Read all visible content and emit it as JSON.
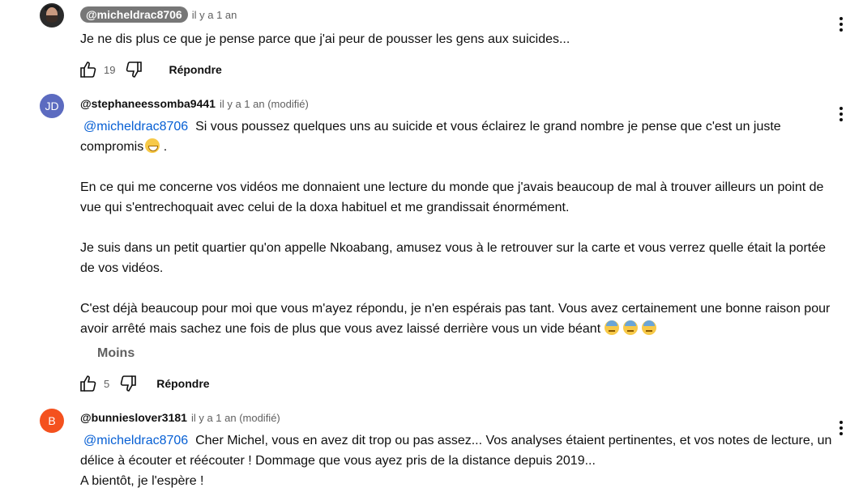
{
  "comments": [
    {
      "author": "@micheldrac8706",
      "time": "il y a 1 an",
      "text": "Je ne dis plus ce que je pense parce que j'ai peur de pousser les gens aux suicides...",
      "likes": "19",
      "reply_label": "Répondre"
    },
    {
      "author": "@stephaneessomba9441",
      "avatar_initials": "JD",
      "time": "il y a 1 an (modifié)",
      "mention": "@micheldrac8706",
      "p1": "Si vous poussez quelques uns au suicide et vous éclairez le grand nombre je pense que c'est un juste compromis",
      "p1_end": ".",
      "p2": "En ce qui me concerne vos vidéos me donnaient une lecture du monde que j'avais beaucoup de mal à trouver ailleurs un point de vue qui s'entrechoquait avec celui de la doxa habituel et me grandissait énormément.",
      "p3": "Je suis dans un petit quartier qu'on appelle Nkoabang, amusez vous à le retrouver sur la carte et vous verrez quelle était la portée de vos vidéos.",
      "p4": "C'est déjà beaucoup pour moi que vous m'ayez répondu, je n'en espérais pas tant. Vous avez certainement une bonne raison pour avoir arrêté mais sachez une fois de plus que vous avez laissé derrière vous un vide béant",
      "show_less": "Moins",
      "likes": "5",
      "reply_label": "Répondre"
    },
    {
      "author": "@bunnieslover3181",
      "avatar_initials": "B",
      "time": "il y a 1 an (modifié)",
      "mention": "@micheldrac8706",
      "text": "Cher Michel, vous en avez dit trop ou pas assez... Vos analyses étaient pertinentes, et vos notes de lecture, un délice à écouter et réécouter ! Dommage que vous ayez pris de la distance depuis 2019...",
      "text_line2": "A bientôt, je l'espère !"
    }
  ]
}
